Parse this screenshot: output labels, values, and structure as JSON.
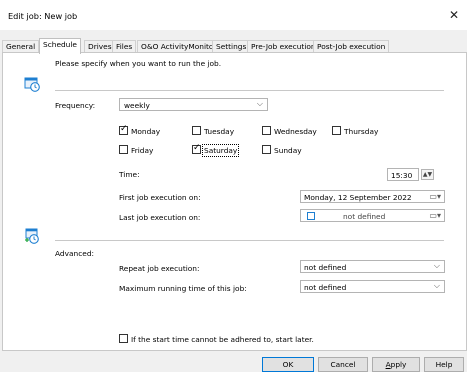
{
  "window": {
    "title": "Edit job: New job",
    "close_glyph": "✕"
  },
  "tabs": [
    {
      "label": "General"
    },
    {
      "label": "Schedule"
    },
    {
      "label": "Drives"
    },
    {
      "label": "Files"
    },
    {
      "label": "O&O ActivityMonitor"
    },
    {
      "label": "Settings"
    },
    {
      "label": "Pre-Job execution"
    },
    {
      "label": "Post-Job execution"
    }
  ],
  "active_tab": "Schedule",
  "schedule": {
    "intro": "Please specify when you want to run the job.",
    "frequency_label": "Frequency:",
    "frequency_value": "weekly",
    "days": [
      {
        "label": "Monday",
        "checked": true
      },
      {
        "label": "Tuesday",
        "checked": false
      },
      {
        "label": "Wednesday",
        "checked": false
      },
      {
        "label": "Thursday",
        "checked": false
      },
      {
        "label": "Friday",
        "checked": false
      },
      {
        "label": "Saturday",
        "checked": true
      },
      {
        "label": "Sunday",
        "checked": false
      }
    ],
    "time_label": "Time:",
    "time_value": "15:30",
    "first_label": "First job execution on:",
    "first_value": "Monday, 12 September 2022",
    "last_label": "Last job execution on:",
    "last_value": "not defined",
    "last_checked": false
  },
  "advanced": {
    "label": "Advanced:",
    "repeat_label": "Repeat job execution:",
    "repeat_value": "not defined",
    "max_label": "Maximum running time of this job:",
    "max_value": "not defined",
    "late_start_label": "If the start time cannot be adhered to, start later.",
    "late_start_checked": false
  },
  "buttons": {
    "ok": "OK",
    "cancel": "Cancel",
    "apply": "Apply",
    "help": "Help"
  },
  "icons": {
    "spin_glyph": "▲▼",
    "dropdown_glyph": "⌵"
  },
  "colors": {
    "accent": "#0078d7",
    "icon_blue": "#1e7fd1",
    "icon_green": "#27a844"
  }
}
